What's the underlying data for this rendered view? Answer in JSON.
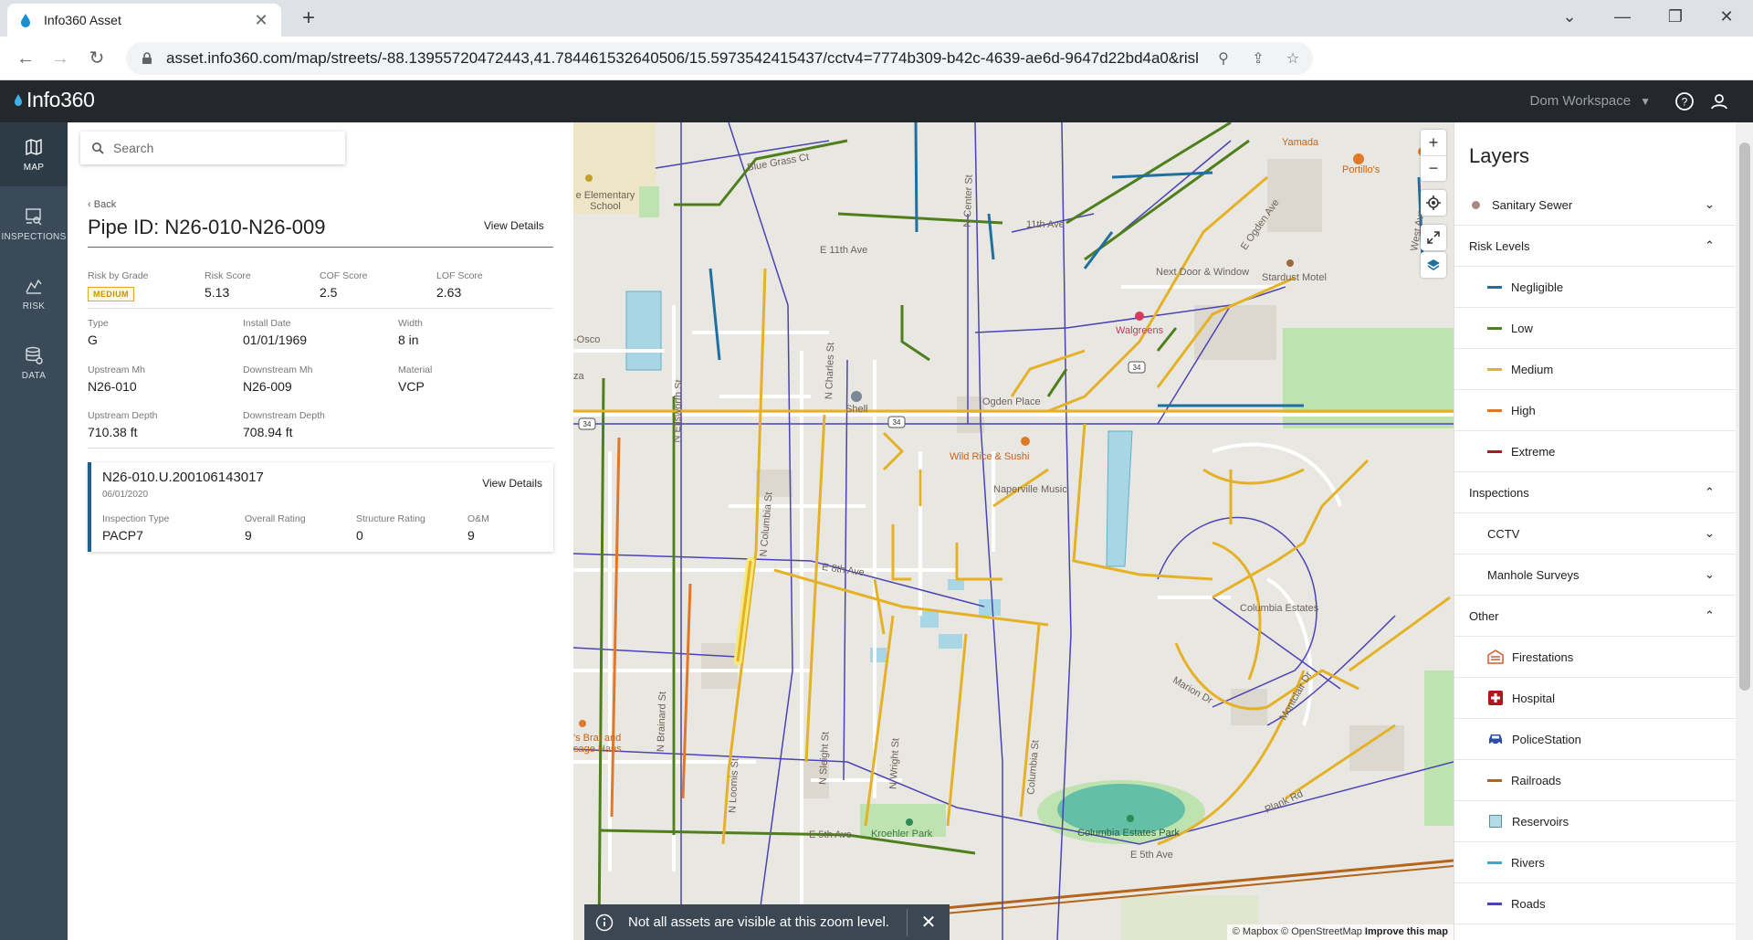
{
  "browser": {
    "tab_title": "Info360 Asset",
    "url": "asset.info360.com/map/streets/-88.13955720472443,41.784461532640506/15.5973542415437/cctv4=7774b309-b42c-4639-ae6d-9647d22bd4a0&risk_levels_medium:wwPip..."
  },
  "app": {
    "logo": "Info360",
    "workspace": "Dom Workspace"
  },
  "nav": [
    {
      "label": "MAP",
      "icon": "map-icon"
    },
    {
      "label": "INSPECTIONS",
      "icon": "inspections-icon"
    },
    {
      "label": "RISK",
      "icon": "risk-icon"
    },
    {
      "label": "DATA",
      "icon": "data-icon"
    }
  ],
  "panel": {
    "search_placeholder": "Search",
    "back": "Back",
    "title": "Pipe ID: N26-010-N26-009",
    "view_details": "View Details",
    "fields": {
      "risk_by_grade": {
        "label": "Risk by Grade",
        "value": "MEDIUM"
      },
      "risk_score": {
        "label": "Risk Score",
        "value": "5.13"
      },
      "cof_score": {
        "label": "COF Score",
        "value": "2.5"
      },
      "lof_score": {
        "label": "LOF Score",
        "value": "2.63"
      },
      "type": {
        "label": "Type",
        "value": "G"
      },
      "install_date": {
        "label": "Install Date",
        "value": "01/01/1969"
      },
      "width": {
        "label": "Width",
        "value": "8 in"
      },
      "upstream_mh": {
        "label": "Upstream Mh",
        "value": "N26-010"
      },
      "downstream_mh": {
        "label": "Downstream Mh",
        "value": "N26-009"
      },
      "material": {
        "label": "Material",
        "value": "VCP"
      },
      "upstream_depth": {
        "label": "Upstream Depth",
        "value": "710.38 ft"
      },
      "downstream_depth": {
        "label": "Downstream Depth",
        "value": "708.94 ft"
      }
    },
    "inspection": {
      "title": "N26-010.U.200106143017",
      "date": "06/01/2020",
      "view_details": "View Details",
      "inspection_type": {
        "label": "Inspection Type",
        "value": "PACP7"
      },
      "overall_rating": {
        "label": "Overall Rating",
        "value": "9"
      },
      "structure_rating": {
        "label": "Structure Rating",
        "value": "0"
      },
      "om": {
        "label": "O&M",
        "value": "9"
      }
    }
  },
  "map": {
    "toast": "Not all assets are visible at this zoom level.",
    "attribution_a": "© Mapbox © OpenStreetMap",
    "attribution_b": "Improve this map",
    "labels": {
      "school": "e Elementary School",
      "blue_grass": "Blue Grass Ct",
      "e11th": "E 11th Ave",
      "11th": "11th Ave",
      "yamada": "Yamada",
      "portillos": "Portillo's",
      "next_door": "Next Door & Window",
      "stardust": "Stardust Motel",
      "walgreens": "Walgreens",
      "ogden_place": "Ogden Place",
      "shell": "Shell",
      "wild_rice": "Wild Rice & Sushi",
      "music": "Naperville Music",
      "osco": "-Osco",
      "za": "za",
      "e8th": "E 8th Ave",
      "columbia_estates": "Columbia Estates",
      "kroehler": "Kroehler Park",
      "columbia_park": "Columbia Estates Park",
      "e5th": "E 5th Ave",
      "e5th_b": "E 5th Ave",
      "brats": "'s Brat and sage Haus",
      "plank": "Plank Rd",
      "marion": "Marion Dr",
      "montclair": "Montclair Dr",
      "west_ave": "West Ave",
      "ogden_ave": "E Ogden Ave",
      "n_columbia": "N Columbia St",
      "n_sleight": "N Sleight St",
      "n_wright": "N Wright St",
      "n_loomis": "N Loomis St",
      "n_ellsworth": "N Ellsworth St",
      "n_brainard": "N Brainard St",
      "n_center": "N Center St",
      "columbia_st": "Columbia St",
      "n_charles": "N Charles St",
      "route34a": "34",
      "route34b": "34",
      "route34c": "34"
    }
  },
  "layers": {
    "title": "Layers",
    "sanitary_sewer": "Sanitary Sewer",
    "risk_levels": "Risk Levels",
    "negligible": "Negligible",
    "low": "Low",
    "medium": "Medium",
    "high": "High",
    "extreme": "Extreme",
    "inspections": "Inspections",
    "cctv": "CCTV",
    "manhole_surveys": "Manhole Surveys",
    "other": "Other",
    "firestations": "Firestations",
    "hospital": "Hospital",
    "policestation": "PoliceStation",
    "railroads": "Railroads",
    "reservoirs": "Reservoirs",
    "rivers": "Rivers",
    "roads": "Roads",
    "colors": {
      "negligible": "#1f6fa0",
      "low": "#4f7f1c",
      "medium": "#e5b126",
      "high": "#e0782a",
      "extreme": "#b1161c",
      "railroads": "#b4651c",
      "reservoirs": "#b3dbe8",
      "rivers": "#3ba7c9",
      "roads": "#4b43b5"
    }
  }
}
